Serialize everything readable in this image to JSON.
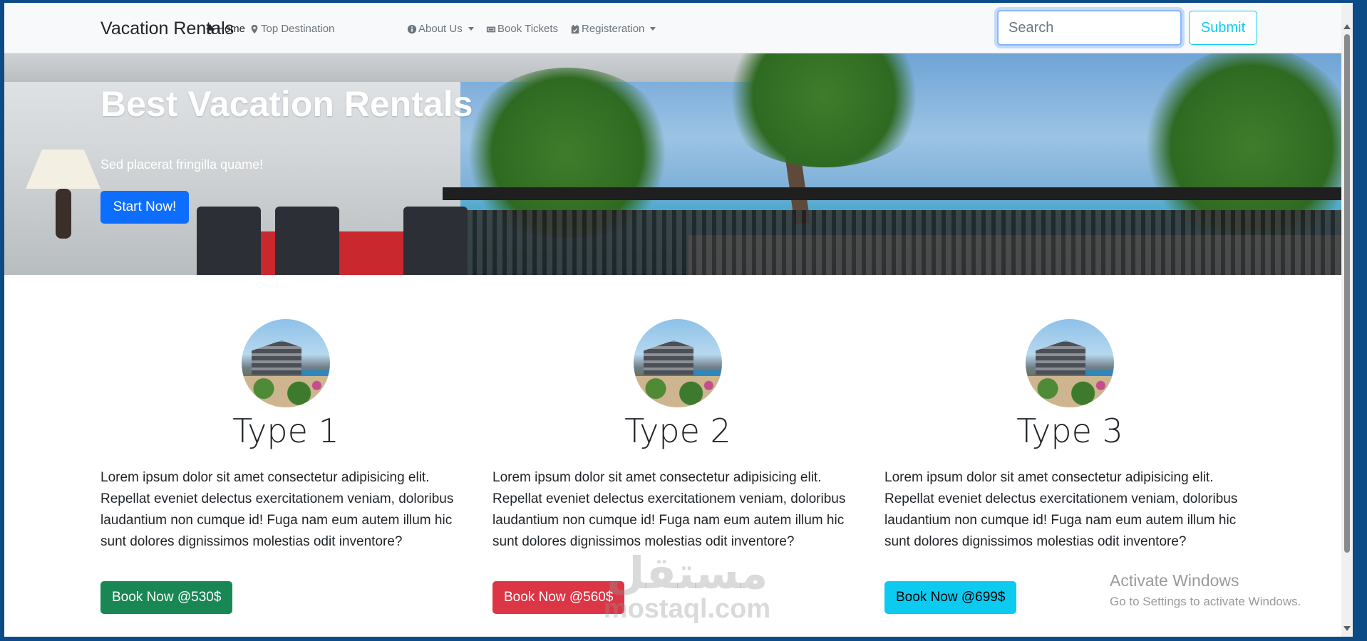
{
  "navbar": {
    "brand": "Vacation Rentals",
    "links": [
      {
        "label": "Home",
        "icon": "home-icon"
      },
      {
        "label": "Top Destination",
        "icon": "map-pin-icon"
      },
      {
        "label": "About Us",
        "icon": "info-circle-icon"
      },
      {
        "label": "Book Tickets",
        "icon": "ticket-icon"
      },
      {
        "label": "Registeration",
        "icon": "calendar-check-icon"
      }
    ],
    "search_placeholder": "Search",
    "submit_label": "Submit"
  },
  "hero": {
    "title": "Best Vacation Rentals",
    "subtitle": "Sed placerat fringilla quame!",
    "cta_label": "Start Now!"
  },
  "cards": [
    {
      "title": "Type 1",
      "text": "Lorem ipsum dolor sit amet consectetur adipisicing elit. Repellat eveniet delectus exercitationem veniam, doloribus laudantium non cumque id! Fuga nam eum autem illum hic sunt dolores dignissimos molestias odit inventore?",
      "button": "Book Now @530$"
    },
    {
      "title": "Type 2",
      "text": "Lorem ipsum dolor sit amet consectetur adipisicing elit. Repellat eveniet delectus exercitationem veniam, doloribus laudantium non cumque id! Fuga nam eum autem illum hic sunt dolores dignissimos molestias odit inventore?",
      "button": "Book Now @560$"
    },
    {
      "title": "Type 3",
      "text": "Lorem ipsum dolor sit amet consectetur adipisicing elit. Repellat eveniet delectus exercitationem veniam, doloribus laudantium non cumque id! Fuga nam eum autem illum hic sunt dolores dignissimos molestias odit inventore?",
      "button": "Book Now @699$"
    }
  ],
  "colors": {
    "primary": "#0d6efd",
    "success": "#198754",
    "danger": "#dc3545",
    "info": "#0dcaf0"
  },
  "watermark": {
    "logo_arabic": "مستقل",
    "logo_latin": "mostaql.com"
  },
  "os_overlay": {
    "line1": "Activate Windows",
    "line2": "Go to Settings to activate Windows."
  }
}
